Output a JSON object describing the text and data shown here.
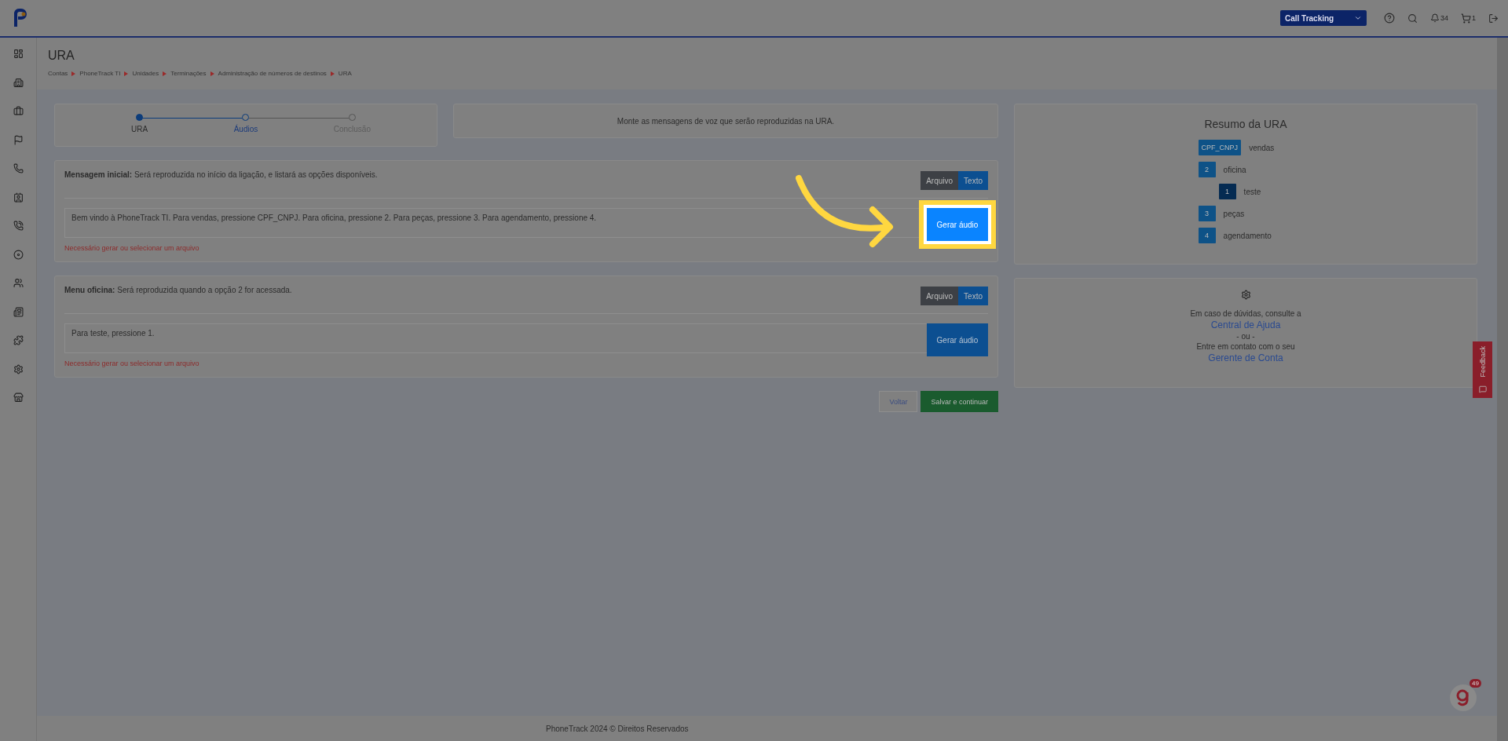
{
  "topbar": {
    "product_select": "Call Tracking",
    "notifications": "34",
    "cart": "1"
  },
  "header": {
    "title": "URA",
    "breadcrumb": [
      "Contas",
      "PhoneTrack TI",
      "Unidades",
      "Terminações",
      "Administração de números de destinos",
      "URA"
    ]
  },
  "stepper": [
    {
      "label": "URA",
      "done": true,
      "selected": false
    },
    {
      "label": "Áudios",
      "done": false,
      "selected": true
    },
    {
      "label": "Conclusão",
      "done": false,
      "selected": false
    }
  ],
  "info": "Monte as mensagens de voz que serão reproduzidas na URA.",
  "messages": [
    {
      "title": "Mensagem inicial:",
      "description": "Será reproduzida no início da ligação, e listará as opções disponíveis.",
      "modes": [
        {
          "label": "Arquivo",
          "selected": false
        },
        {
          "label": "Texto",
          "selected": true
        }
      ],
      "text": "Bem vindo à PhoneTrack TI. Para vendas, pressione CPF_CNPJ. Para oficina, pressione 2. Para peças, pressione 3. Para agendamento, pressione 4.",
      "button": "Gerar áudio",
      "highlighted": true,
      "error": "Necessário gerar ou selecionar um arquivo"
    },
    {
      "title": "Menu oficina:",
      "description": "Será reproduzida quando a opção 2 for acessada.",
      "modes": [
        {
          "label": "Arquivo",
          "selected": false
        },
        {
          "label": "Texto",
          "selected": true
        }
      ],
      "text": "Para teste, pressione 1.",
      "button": "Gerar áudio",
      "highlighted": false,
      "error": "Necessário gerar ou selecionar um arquivo"
    }
  ],
  "actions": {
    "back": "Voltar",
    "save": "Salvar e continuar"
  },
  "summary": {
    "title": "Resumo da URA",
    "items": [
      {
        "key": "CPF_CNPJ",
        "label": "vendas"
      },
      {
        "key": "2",
        "label": "oficina",
        "children": [
          {
            "key": "1",
            "label": "teste"
          }
        ]
      },
      {
        "key": "3",
        "label": "peças"
      },
      {
        "key": "4",
        "label": "agendamento"
      }
    ]
  },
  "help": {
    "line1": "Em caso de dúvidas, consulte a",
    "link1": "Central de Ajuda",
    "or": "- ou -",
    "line2": "Entre em contato com o seu",
    "link2": "Gerente de Conta"
  },
  "feedback": "Feedback",
  "chat_badge": "49",
  "footer": "PhoneTrack 2024 © Direitos Reservados"
}
